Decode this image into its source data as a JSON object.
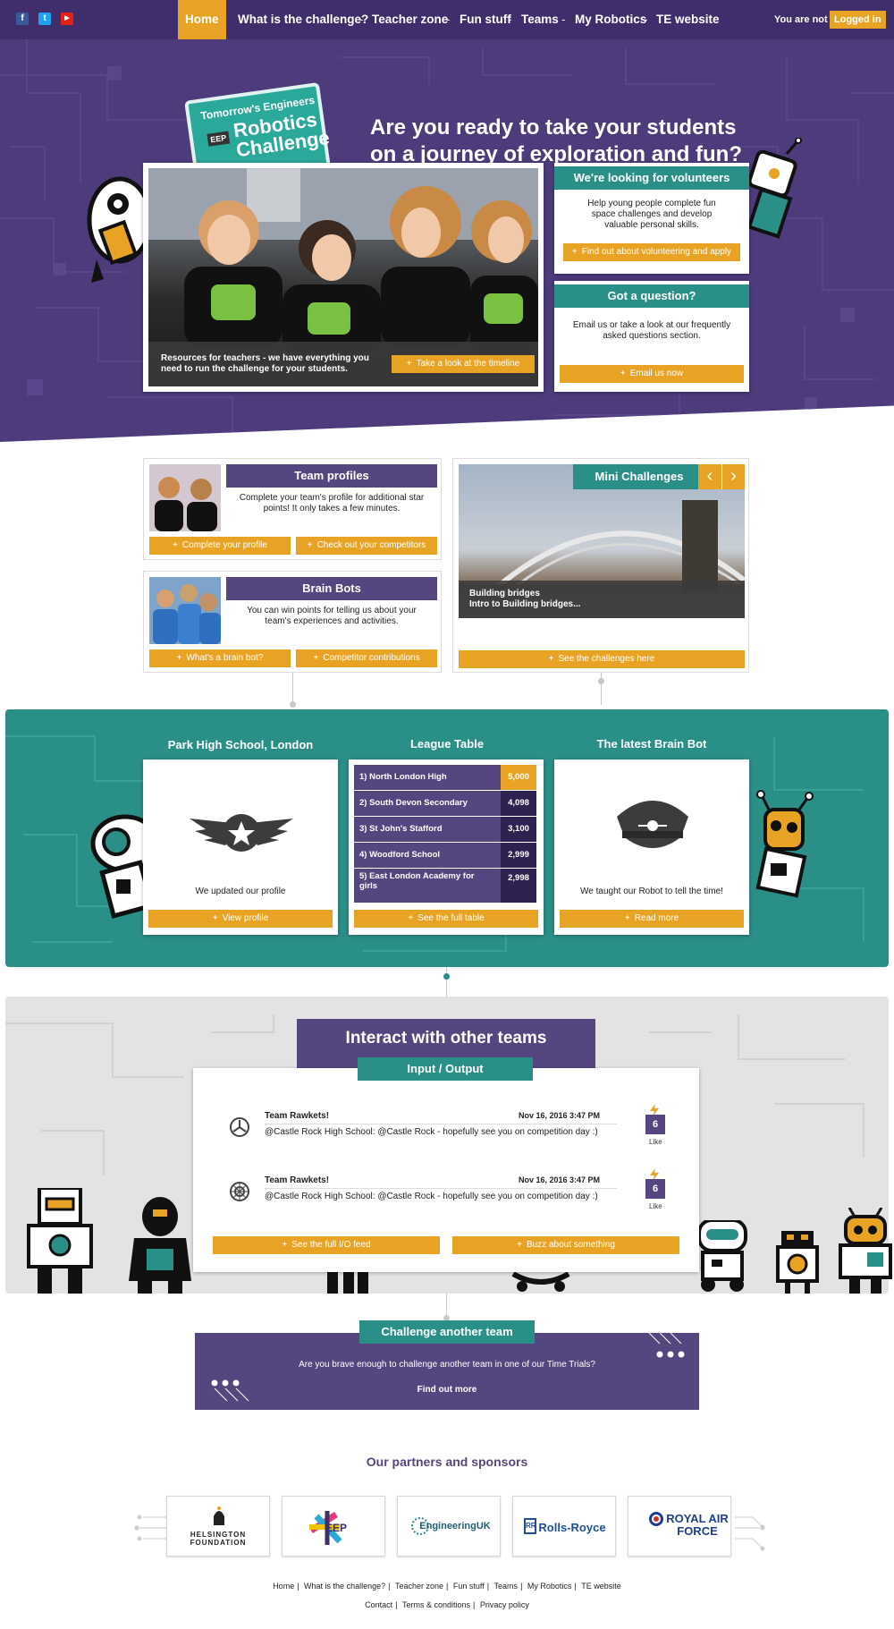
{
  "nav": {
    "social": [
      "f",
      "t",
      "▶"
    ],
    "items": [
      "Home",
      "What is the challenge?",
      "Teacher zone",
      "Fun stuff",
      "Teams",
      "My Robotics",
      "TE website"
    ],
    "user_text": "You are not",
    "login_label": "Logged in"
  },
  "hero": {
    "logo_small": "Tomorrow's Engineers",
    "logo_eep": "EEP",
    "logo_big1": "Robotics",
    "logo_big2": "Challenge",
    "title": "Are you ready to take your students on a journey of exploration and fun?",
    "photo_caption": "Resources for teachers - we have everything you need to run the challenge for your students.",
    "timeline_button": "Take a look at the timeline",
    "volunteers": {
      "title": "We're looking for volunteers",
      "text": "Help young people complete fun space challenges and develop valuable personal skills.",
      "button": "Find out about volunteering and apply"
    },
    "question": {
      "title": "Got a question?",
      "text": "Email us or take a look at our frequently asked questions section.",
      "button": "Email us now"
    }
  },
  "team_profiles": {
    "title": "Team profiles",
    "text": "Complete your team's profile for additional star points! It only takes a few minutes.",
    "btn1": "Complete your profile",
    "btn2": "Check out your competitors"
  },
  "brain_bots": {
    "title": "Brain Bots",
    "text": "You can win points for telling us about your team's experiences and activities.",
    "btn1": "What's a brain bot?",
    "btn2": "Competitor contributions"
  },
  "mini": {
    "title": "Mini Challenges",
    "prev": "‹",
    "next": "›",
    "caption1": "Building bridges",
    "caption2": "Intro to Building bridges...",
    "button": "See the challenges here"
  },
  "school": {
    "title": "Park High School, London",
    "text": "We updated our profile",
    "button": "View profile"
  },
  "league": {
    "title": "League Table",
    "rows": [
      {
        "name": "1) North London High",
        "value": "5,000"
      },
      {
        "name": "2) South Devon Secondary",
        "value": "4,098"
      },
      {
        "name": "3) St John's Stafford",
        "value": "3,100"
      },
      {
        "name": "4) Woodford School",
        "value": "2,999"
      },
      {
        "name": "5) East London Academy for girls",
        "value": "2,998"
      }
    ],
    "button": "See the full table"
  },
  "brainbot": {
    "title": "The latest Brain Bot",
    "text": "We taught our Robot to tell the time!",
    "button": "Read more"
  },
  "interact": {
    "title": "Interact with other teams",
    "subtitle": "Input / Output",
    "posts": [
      {
        "name": "Team Rawkets!",
        "date": "Nov 16, 2016 3:47 PM",
        "body": "@Castle Rock High School: @Castle Rock - hopefully see you on competition day :)",
        "likes": "6",
        "like_label": "Like"
      },
      {
        "name": "Team Rawkets!",
        "date": "Nov 16, 2016 3:47 PM",
        "body": "@Castle Rock High School: @Castle Rock - hopefully see you on competition day :)",
        "likes": "6",
        "like_label": "Like"
      }
    ],
    "btn1": "See the full I/O feed",
    "btn2": "Buzz about something"
  },
  "challenge": {
    "title": "Challenge another team",
    "text": "Are you brave enough to challenge another team in one of our Time Trials?",
    "link": "Find out more"
  },
  "partners": {
    "title": "Our partners and sponsors",
    "logos": [
      "HELSINGTON FOUNDATION",
      "EEP",
      "EngineeringUK",
      "Rolls-Royce",
      "ROYAL AIR FORCE"
    ]
  },
  "footer": {
    "row1": [
      "Home",
      "What is the challenge?",
      "Teacher zone",
      "Fun stuff",
      "Teams",
      "My Robotics",
      "TE website"
    ],
    "row2": [
      "Contact",
      "Terms & conditions",
      "Privacy policy"
    ]
  },
  "colors": {
    "purple": "#554680",
    "dark_purple": "#3f2e6b",
    "teal": "#2a8f87",
    "orange": "#e8a325"
  }
}
